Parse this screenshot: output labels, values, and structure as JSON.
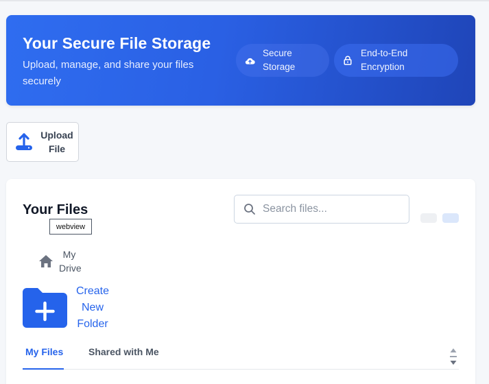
{
  "hero": {
    "title": "Your Secure File Storage",
    "subtitle": "Upload, manage, and share your files securely",
    "badges": [
      {
        "icon": "cloud-upload-icon",
        "line1": "Secure",
        "line2": "Storage"
      },
      {
        "icon": "lock-icon",
        "line1": "End-to-End",
        "line2": "Encryption"
      }
    ]
  },
  "upload": {
    "line1": "Upload",
    "line2": "File",
    "icon": "upload-icon"
  },
  "files": {
    "title": "Your Files",
    "tooltip": "webview",
    "search_placeholder": "Search files...",
    "breadcrumb": {
      "icon": "home-icon",
      "line1": "My",
      "line2": "Drive"
    },
    "new_folder": {
      "icon": "folder-plus-icon",
      "line1": "Create",
      "line2": "New",
      "line3": "Folder"
    },
    "tabs": [
      {
        "label": "My Files",
        "active": true
      },
      {
        "label": "Shared with Me",
        "active": false
      }
    ]
  },
  "colors": {
    "accent": "#2563eb",
    "hero_start": "#2f6df0",
    "hero_end": "#1f45b8"
  }
}
